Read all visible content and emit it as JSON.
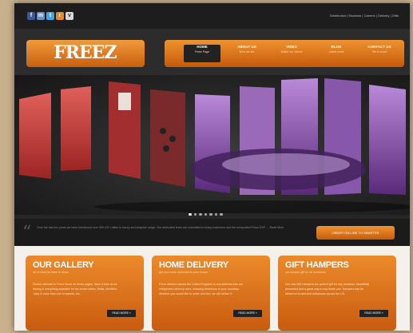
{
  "social": [
    "f",
    "m",
    "t",
    "r",
    "v"
  ],
  "colors": {
    "facebook": "#3b5998",
    "mail": "#6b8fc9",
    "twitter": "#4aa3df",
    "rss": "#e38a2a",
    "other": "#d9d9d9",
    "accent": "#e0771e"
  },
  "top_links": "Distribution | Stockists | Careers | Delivery | Gifts",
  "logo": "FREEZ",
  "nav": [
    {
      "title": "HOME",
      "sub": "Freez Page"
    },
    {
      "title": "ABOUT US",
      "sub": "Who we are"
    },
    {
      "title": "VIDEO",
      "sub": "Watch our videos"
    },
    {
      "title": "BLOG",
      "sub": "Latest news"
    },
    {
      "title": "CONTACT US",
      "sub": "Get in touch"
    }
  ],
  "info": {
    "text": "Over the last two years we have introduced over 300 ICE Lollies in luxury and bespoke range. Our dedicated team are committed to bring customers and the unequalled Freez EXP. ... Read More",
    "button": "ORDER ON-LINE TO SMARTER"
  },
  "boxes": [
    {
      "title": "OUR GALLERY",
      "sub": "All of what we have to share",
      "text": "Photos relevant to Freez found on these pages. Have a look at our tasting & everything available for ice-cream lollies, Walls, McVities, Juicy & more than one of sweets, etc.",
      "more": "READ MORE »"
    },
    {
      "title": "HOME DELIVERY",
      "sub": "get your order delivered to your house",
      "text": "Freez delivers across the United Kingdom to any address with our refrigerated delivery vans, ensuring freshness to your doorstep. Whether you would like to order one box, we will deliver it.",
      "more": "READ MORE »"
    },
    {
      "title": "GIFT HAMPERS",
      "sub": "our hamper gift for all occasions",
      "text": "Our new Gift Hampers are perfect gift for any occasion; beautifully presented and a great way to say thank you. Hampers can be delivered to selected addresses across the UK.",
      "more": "READ MORE »"
    }
  ]
}
